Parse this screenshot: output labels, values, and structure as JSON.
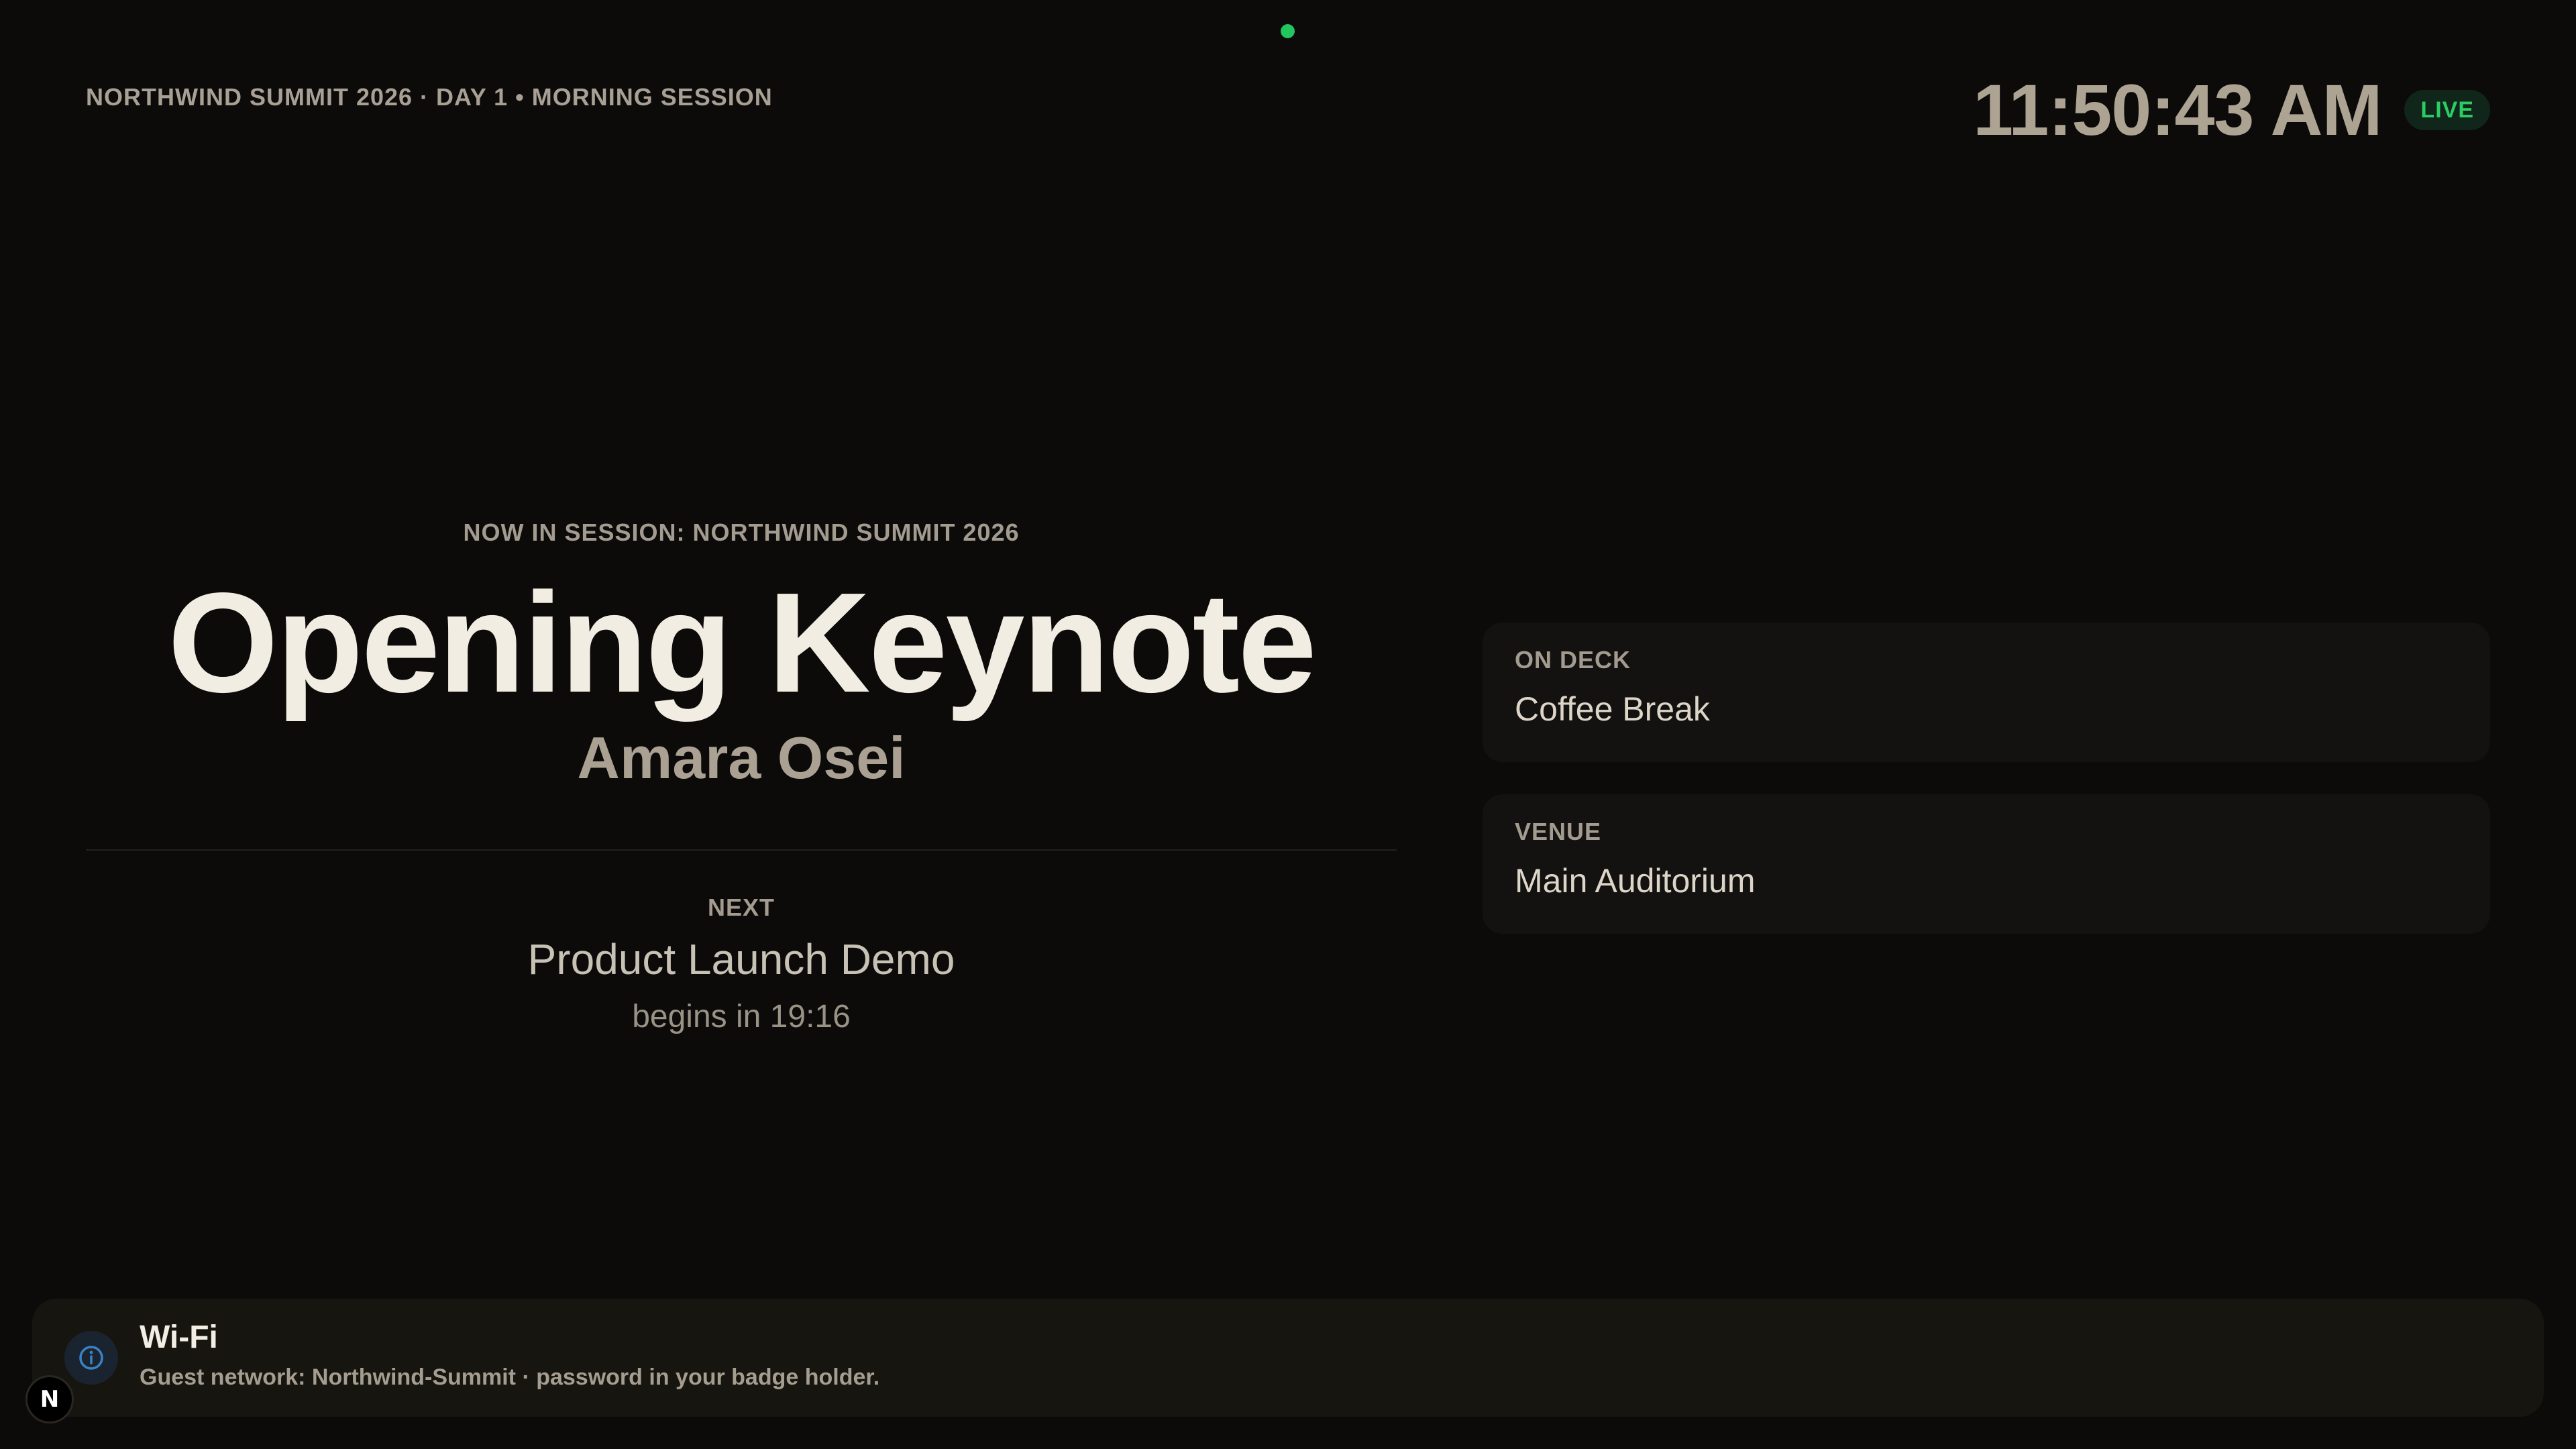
{
  "header": {
    "event_line": "NORTHWIND SUMMIT 2026 · DAY 1 • MORNING SESSION",
    "clock": "11:50:43 AM",
    "live_badge": "LIVE"
  },
  "session": {
    "label": "NOW IN SESSION: NORTHWIND SUMMIT 2026",
    "title": "Opening Keynote",
    "speaker": "Amara Osei"
  },
  "next": {
    "label": "NEXT",
    "title": "Product Launch Demo",
    "countdown": "begins in 19:16"
  },
  "cards": [
    {
      "label": "ON DECK",
      "value": "Coffee Break"
    },
    {
      "label": "VENUE",
      "value": "Main Auditorium"
    }
  ],
  "notice": {
    "icon": "info-icon",
    "title": "Wi-Fi",
    "body": "Guest network: Northwind-Summit · password in your badge holder."
  },
  "brand_badge": "N",
  "colors": {
    "background": "#0c0b0a",
    "live_green": "#22c55e",
    "info_blue": "#3b82c4"
  }
}
